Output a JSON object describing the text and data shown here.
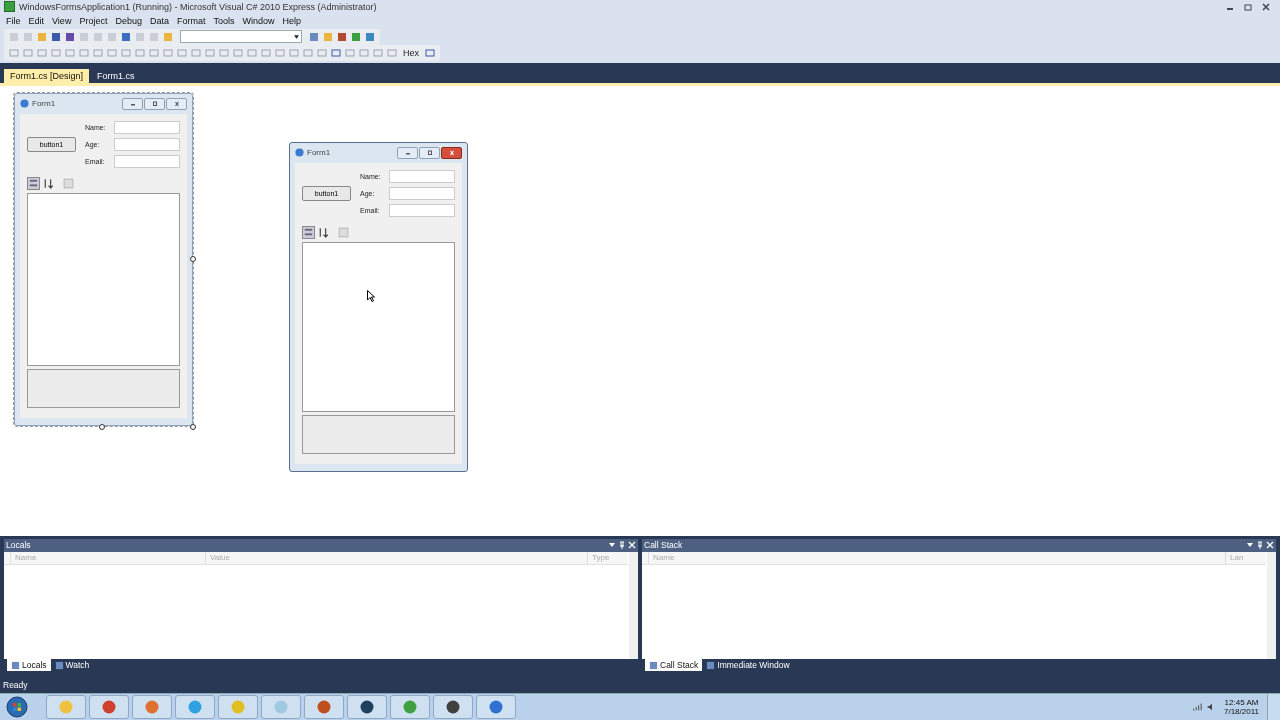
{
  "window": {
    "title": "WindowsFormsApplication1 (Running) - Microsoft Visual C# 2010 Express (Administrator)"
  },
  "menu": [
    "File",
    "Edit",
    "View",
    "Project",
    "Debug",
    "Data",
    "Format",
    "Tools",
    "Window",
    "Help"
  ],
  "toolbar": {
    "hex_label": "Hex"
  },
  "document_tabs": [
    {
      "label": "Form1.cs [Design]",
      "selected": true
    },
    {
      "label": "Form1.cs",
      "selected": false
    }
  ],
  "forms": [
    {
      "title": "Form1",
      "kind": "designer",
      "active": false,
      "button": "button1",
      "field_labels": [
        "Name:",
        "Age:",
        "Email:"
      ]
    },
    {
      "title": "Form1",
      "kind": "running",
      "active": true,
      "button": "button1",
      "field_labels": [
        "Name:",
        "Age:",
        "Email:"
      ]
    }
  ],
  "panels": [
    {
      "title": "Locals",
      "columns": [
        "Name",
        "Value",
        "Type"
      ],
      "tabs": [
        {
          "label": "Locals",
          "selected": true
        },
        {
          "label": "Watch",
          "selected": false
        }
      ]
    },
    {
      "title": "Call Stack",
      "columns": [
        "Name",
        "Lan"
      ],
      "tabs": [
        {
          "label": "Call Stack",
          "selected": true
        },
        {
          "label": "Immediate Window",
          "selected": false
        }
      ]
    }
  ],
  "status_bar": "Ready",
  "taskbar": {
    "time": "12:45 AM",
    "date": "7/18/2011"
  }
}
